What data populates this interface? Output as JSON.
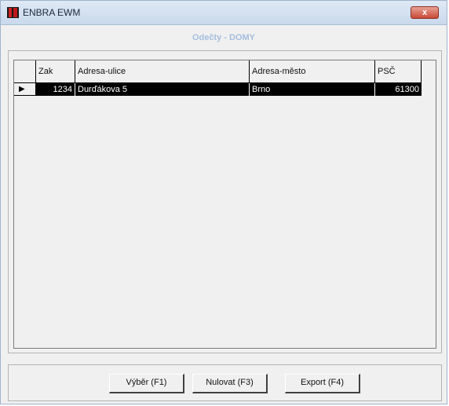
{
  "window": {
    "title": "ENBRA EWM",
    "close_label": "x"
  },
  "header": {
    "subtitle": "Odečty - DOMY"
  },
  "grid": {
    "columns": [
      "Zak",
      "Adresa-ulice",
      "Adresa-město",
      "PSČ"
    ],
    "rows": [
      {
        "indicator": "▶",
        "zak": "1234",
        "ulice": "Durďákova 5",
        "mesto": "Brno",
        "psc": "61300"
      }
    ]
  },
  "buttons": {
    "vybir": "Výběr (F1)",
    "nulovat": "Nulovat (F3)",
    "export": "Export (F4)"
  }
}
